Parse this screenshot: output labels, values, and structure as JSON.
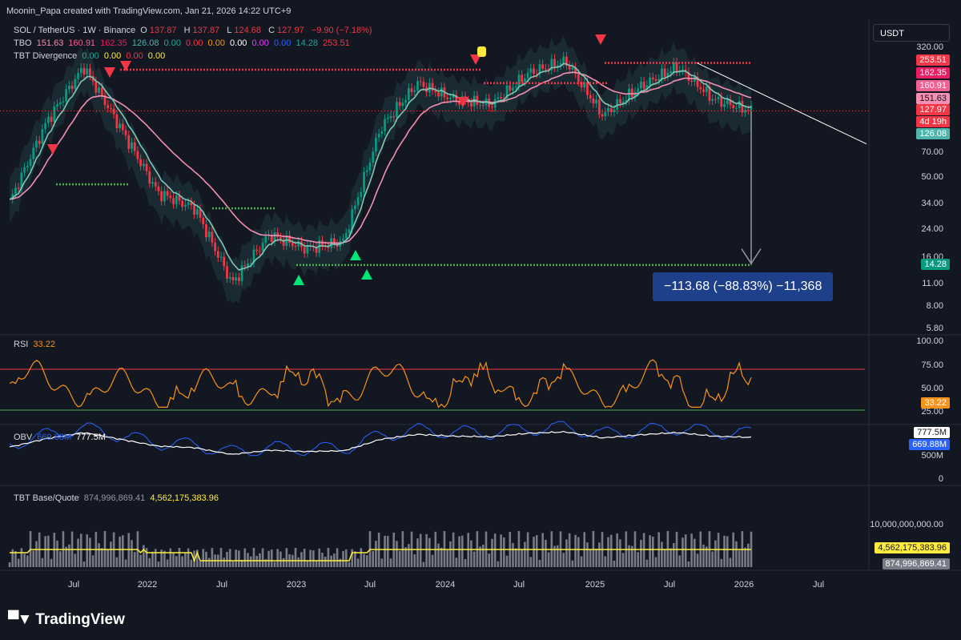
{
  "header": {
    "attribution": "Moonin_Papa created with TradingView.com, Jan 21, 2026 14:22 UTC+9"
  },
  "symbol": {
    "title": "SOL / TetherUS · 1W · Binance",
    "o_label": "O",
    "o": "137.87",
    "h_label": "H",
    "h": "137.87",
    "l_label": "L",
    "l": "124.68",
    "c_label": "C",
    "c": "127.97",
    "change": "−9.90 (−7.18%)"
  },
  "tbo": {
    "label": "TBO",
    "values": [
      "151.63",
      "160.91",
      "162.35",
      "126.08",
      "0.00",
      "0.00",
      "0.00",
      "0.00",
      "0.00",
      "0.00",
      "14.28",
      "253.51"
    ]
  },
  "tbt_div": {
    "label": "TBT Divergence",
    "values": [
      "0.00",
      "0.00",
      "0.00",
      "0.00"
    ]
  },
  "currency_button": "USDT",
  "price_axis": [
    "320.00",
    "70.00",
    "50.00",
    "34.00",
    "24.00",
    "16.00",
    "11.00",
    "8.00",
    "5.80"
  ],
  "price_tags": [
    {
      "text": "253.51",
      "color": "#f23645"
    },
    {
      "text": "162.35",
      "color": "#e91e63"
    },
    {
      "text": "160.91",
      "color": "#f06292"
    },
    {
      "text": "151.63",
      "color": "#f48fb1"
    },
    {
      "text": "127.97",
      "color": "#f23645"
    },
    {
      "text": "4d 19h",
      "color": "#f23645"
    },
    {
      "text": "126.08",
      "color": "#4db6ac"
    },
    {
      "text": "14.28",
      "color": "#089981"
    }
  ],
  "measure_label": "−113.68 (−88.83%) −11,368",
  "rsi": {
    "label": "RSI",
    "value": "33.22",
    "axis": [
      "100.00",
      "75.00",
      "50.00",
      "25.00"
    ]
  },
  "obv": {
    "label": "OBV",
    "v1": "669.88M",
    "v2": "777.5M",
    "axis": [
      "500M",
      "0"
    ],
    "tag1": "777.5M",
    "tag2": "669.88M"
  },
  "tbt_bq": {
    "label": "TBT Base/Quote",
    "v1": "874,996,869.41",
    "v2": "4,562,175,383.96",
    "axis": [
      "10,000,000,000.00"
    ],
    "tag1": "4,562,175,383.96",
    "tag2": "874,996,869.41"
  },
  "time_axis": [
    "Jul",
    "2022",
    "Jul",
    "2023",
    "Jul",
    "2024",
    "Jul",
    "2025",
    "Jul",
    "2026",
    "Jul"
  ],
  "brand": "TradingView",
  "colors": {
    "up": "#089981",
    "down": "#f23645",
    "ema_fast": "#81c7b4",
    "ema_slow": "#f48fb1",
    "rsi": "#f7931a",
    "obv": "#2962ff",
    "vol_ma": "#ffeb3b"
  },
  "chart_data": {
    "type": "line",
    "title": "SOL / TetherUS · 1W · Binance",
    "log_scale": true,
    "x": [
      "2021-06",
      "2021-09",
      "2021-11",
      "2022-03",
      "2022-06",
      "2022-09",
      "2022-12",
      "2023-03",
      "2023-06",
      "2023-09",
      "2023-12",
      "2024-03",
      "2024-06",
      "2024-09",
      "2024-12",
      "2025-01",
      "2025-04",
      "2025-07",
      "2025-09",
      "2025-11",
      "2026-01"
    ],
    "series": [
      {
        "values": [
          35,
          110,
          240,
          100,
          40,
          32,
          11,
          22,
          18,
          20,
          100,
          190,
          150,
          140,
          220,
          260,
          120,
          180,
          240,
          150,
          128
        ]
      }
    ],
    "ylim": [
      5.8,
      320
    ],
    "levels": [
      253.51,
      162.35,
      160.91,
      151.63,
      127.97,
      126.08,
      14.28
    ]
  }
}
